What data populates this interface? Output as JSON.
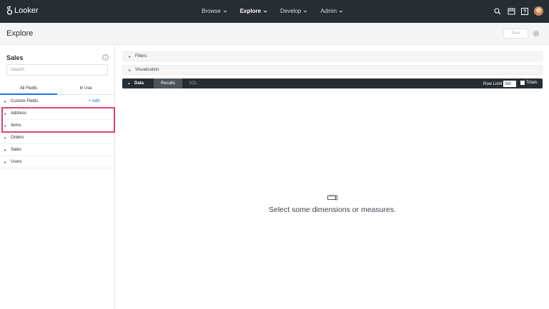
{
  "brand": {
    "name": "Looker"
  },
  "nav": {
    "items": [
      {
        "label": "Browse"
      },
      {
        "label": "Explore"
      },
      {
        "label": "Develop"
      },
      {
        "label": "Admin"
      }
    ]
  },
  "header": {
    "title": "Explore",
    "run_label": "Run"
  },
  "sidebar": {
    "model_title": "Sales",
    "search_placeholder": "Search",
    "tabs": [
      {
        "label": "All Fields"
      },
      {
        "label": "In Use"
      }
    ],
    "add_label": "+ Add",
    "fields": [
      {
        "label": "Custom Fields"
      },
      {
        "label": "Address"
      },
      {
        "label": "Items"
      },
      {
        "label": "Orders"
      },
      {
        "label": "Sales"
      },
      {
        "label": "Users"
      }
    ]
  },
  "main": {
    "filters_label": "Filters",
    "visualization_label": "Visualization",
    "data_label": "Data",
    "results_label": "Results",
    "sql_label": "SQL",
    "row_limit_label": "Row Limit",
    "row_limit_value": "500",
    "totals_label": "Totals",
    "empty_message": "Select some dimensions or measures."
  },
  "colors": {
    "topbar": "#262d33",
    "accent": "#1a73e8",
    "highlight": "#d8417a"
  }
}
